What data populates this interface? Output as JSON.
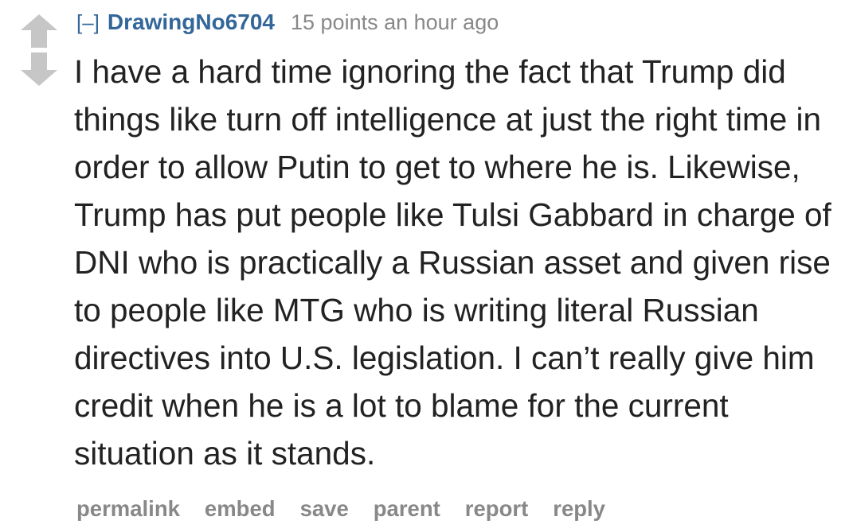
{
  "comment": {
    "expand_label": "[–]",
    "author": "DrawingNo6704",
    "score": "15 points",
    "time": "an hour ago",
    "body": "I have a hard time ignoring the fact that Trump did things like turn off intelligence at just the right time in order to allow Putin to get to where he is. Likewise, Trump has put people like Tulsi Gabbard in charge of DNI who is practically a Russian asset and given rise to people like MTG who is writing literal Russian directives into U.S. legislation. I can’t really give him credit when he is a lot to blame for the current situation as it stands."
  },
  "vote": {
    "upvote_icon": "upvote-arrow-icon",
    "downvote_icon": "downvote-arrow-icon",
    "arrow_color": "#c6c6c6"
  },
  "buttons": [
    "permalink",
    "embed",
    "save",
    "parent",
    "report",
    "reply"
  ],
  "colors": {
    "author": "#336699",
    "meta": "#888888",
    "body_text": "#222222"
  }
}
